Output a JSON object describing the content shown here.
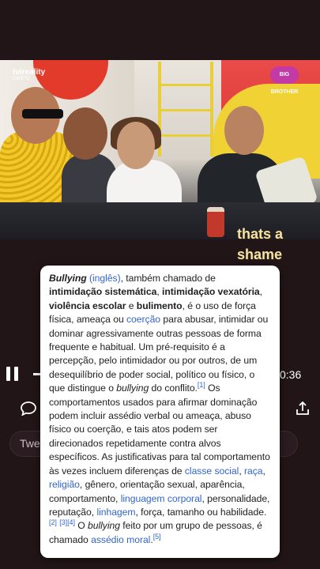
{
  "video": {
    "channel_logo": "tvireality",
    "channel_sub": "DIRETO",
    "show_logo": "BIG BROTHER",
    "caption": [
      "thats a",
      "shame"
    ]
  },
  "player": {
    "pause_icon": "pause-icon",
    "time": "0:36",
    "comment_icon": "comment-icon",
    "share_icon": "share-icon"
  },
  "tweet_input": {
    "text": "Twe"
  },
  "popup": {
    "t1_term": "Bullying",
    "t1_link": "(inglês)",
    "t1_text": ", também chamado de ",
    "t1_bold1": "intimidação sistemática",
    "t1_sep1": ", ",
    "t1_bold2": "intimidação vexatória",
    "t1_sep2": ", ",
    "t1_bold3": "violência escolar",
    "t1_sep3": " e ",
    "t1_bold4": "bulimento",
    "t2": ", é o uso de força física, ameaça ou ",
    "link_coercao": "coerção",
    "t3": " para abusar, intimidar ou dominar agressivamente outras pessoas de forma frequente e habitual. Um pré-requisito é a percepção, pelo intimidador ou por outros, de um desequilíbrio de poder social, político ou físico, o que distingue o ",
    "t3_italic": "bullying",
    "t4": " do conflito.",
    "ref1": "[1]",
    "t5": " Os comportamentos usados para afirmar dominação podem incluir assédio verbal ou ameaça, abuso físico ou coerção, e tais atos podem ser direcionados repetidamente contra alvos específicos. As justificativas para tal comportamento às vezes incluem diferenças de ",
    "link_classe": "classe social",
    "sep_a": ", ",
    "link_raca": "raça",
    "sep_b": ", ",
    "link_religiao": "religião",
    "t6": ", gênero, orientação sexual, aparência, comportamento, ",
    "link_linguagem": "linguagem corporal",
    "t7": ", personalidade, reputação, ",
    "link_linhagem": "linhagem",
    "t8": ", força, tamanho ou habilidade.",
    "ref2": "[2]",
    "ref3": "[3]",
    "ref4": "[4]",
    "t9": " O ",
    "t9_italic": "bullying",
    "t10": " feito por um grupo de pessoas, é chamado ",
    "link_assedio": "assédio moral",
    "t11": ".",
    "ref5": "[5]"
  }
}
